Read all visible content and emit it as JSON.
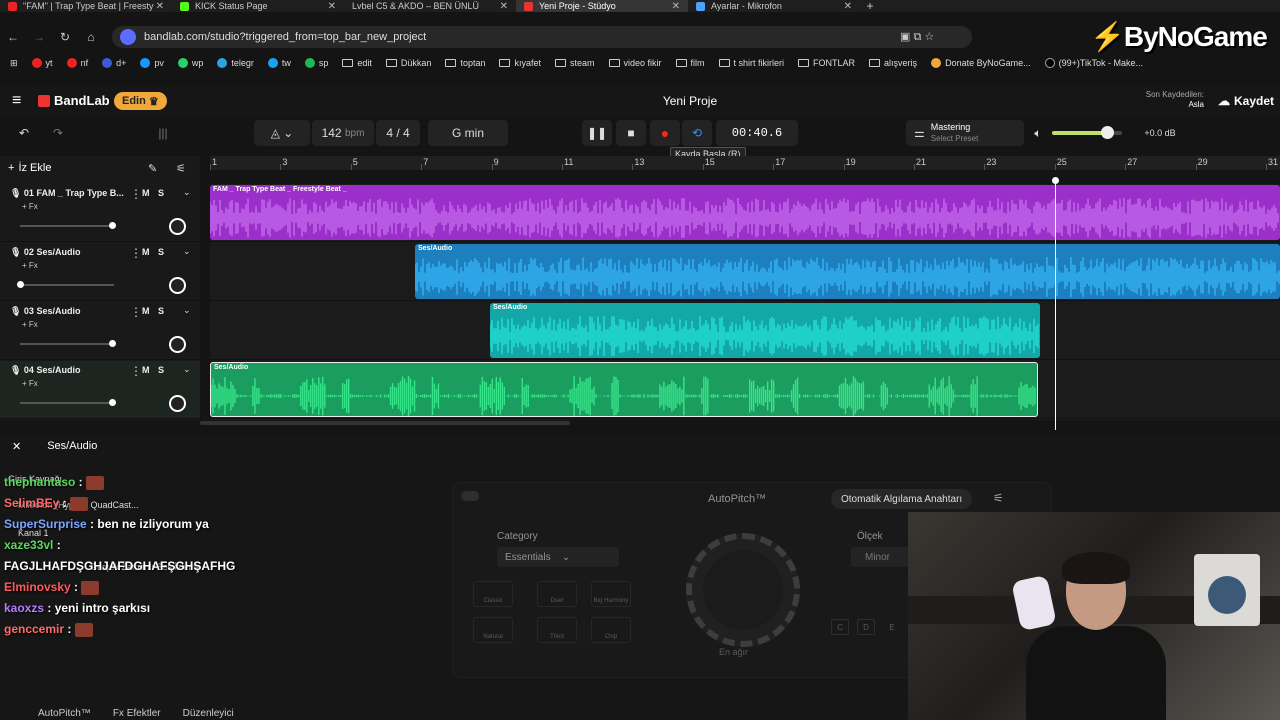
{
  "browser": {
    "tabs": [
      {
        "label": "\"FAM\" | Trap Type Beat | Freesty",
        "color": "#e22"
      },
      {
        "label": "KICK Status Page",
        "color": "#53fc18"
      },
      {
        "label": "Lvbel C5 & AKDO – BEN ÜNLÜ",
        "color": ""
      },
      {
        "label": "Yeni Proje - Stüdyo",
        "color": "#e33"
      },
      {
        "label": "Ayarlar - Mikrofon",
        "color": "#4aa3ff"
      }
    ],
    "url": "bandlab.com/studio?triggered_from=top_bar_new_project",
    "bookmarks": [
      {
        "label": "yt",
        "color": "#e22"
      },
      {
        "label": "nf",
        "color": "#e22"
      },
      {
        "label": "d+",
        "color": "#3b5bd6"
      },
      {
        "label": "pv",
        "color": "#1a98ff"
      },
      {
        "label": "wp",
        "color": "#25d366"
      },
      {
        "label": "telegr",
        "color": "#2aa3e0"
      },
      {
        "label": "tw",
        "color": "#1da1f2"
      },
      {
        "label": "sp",
        "color": "#1db954"
      },
      {
        "label": "edit",
        "color": ""
      },
      {
        "label": "Dükkan",
        "color": ""
      },
      {
        "label": "toptan",
        "color": ""
      },
      {
        "label": "kıyafet",
        "color": ""
      },
      {
        "label": "steam",
        "color": ""
      },
      {
        "label": "video fikir",
        "color": ""
      },
      {
        "label": "film",
        "color": ""
      },
      {
        "label": "t shirt fikirleri",
        "color": ""
      },
      {
        "label": "FONTLAR",
        "color": ""
      },
      {
        "label": "alışveriş",
        "color": ""
      },
      {
        "label": "Donate ByNoGame...",
        "color": "#f1a83a"
      },
      {
        "label": "(99+)TikTok - Make...",
        "color": "#000"
      }
    ],
    "logo": "ByNoGame"
  },
  "bandlab": {
    "logo": "BandLab",
    "edin_label": "Edin",
    "project_title": "Yeni Proje",
    "saved_label": "Son Kaydedilen:",
    "saved_value": "Asla",
    "kaydet_label": "Kaydet"
  },
  "transport": {
    "bpm": "142",
    "bpm_unit": "bpm",
    "time_sig": "4 / 4",
    "key": "G min",
    "time": "00:40.6",
    "tooltip": "Kayda Başla (R)",
    "mastering_title": "Mastering",
    "mastering_sub": "Select Preset",
    "db": "+0.0 dB",
    "volume_level": 0.78
  },
  "tracks_header": {
    "add_label": "İz Ekle"
  },
  "ruler": [
    "1",
    "3",
    "5",
    "7",
    "9",
    "11",
    "13",
    "15",
    "17",
    "19",
    "21",
    "23",
    "25",
    "27",
    "29",
    "31"
  ],
  "tracks": [
    {
      "name": "01  FAM _ Trap Type B...",
      "fx": "+ Fx",
      "ms": "M S",
      "fader": 0.98,
      "clip_label": "FAM _ Trap Type Beat _ Freestyle Beat _",
      "color": "#9b2fc9",
      "wave": "#c46bf0"
    },
    {
      "name": "02  Ses/Audio",
      "fx": "+ Fx",
      "ms": "M S",
      "fader": 0.0,
      "clip_label": "Ses/Audio",
      "color": "#1e7fbf",
      "wave": "#34b4f5"
    },
    {
      "name": "03  Ses/Audio",
      "fx": "+ Fx",
      "ms": "M S",
      "fader": 0.98,
      "clip_label": "Ses/Audio",
      "color": "#13a7a7",
      "wave": "#25e0d8"
    },
    {
      "name": "04  Ses/Audio",
      "fx": "+ Fx",
      "ms": "M S",
      "fader": 0.98,
      "clip_label": "Ses/Audio",
      "color": "#1b9d5f",
      "wave": "#36e58a"
    }
  ],
  "bottom": {
    "title": "Ses/Audio",
    "autopitch_title": "AutoPitch™",
    "auto_key_label": "Otomatik Algılama Anahtarı",
    "category_label": "Category",
    "category_value": "Essentials",
    "modes": [
      "Classic",
      "Duet",
      "Big Harmony",
      "Natural",
      "Third",
      "Chip"
    ],
    "dial_label": "En ağır",
    "scale_label": "Ölçek",
    "scale_value": "Minor",
    "keys": [
      "C",
      "D",
      "E"
    ],
    "footer": [
      "AutoPitch™",
      "Fx  Efektler",
      "Düzenleyici"
    ]
  },
  "chat": [
    {
      "user": "thephantaso",
      "color": "#5cd65c",
      "text": ""
    },
    {
      "user": "SelimBEy",
      "color": "#ff6b6b",
      "text": ""
    },
    {
      "user": "SuperSurprise",
      "color": "#7aa8ff",
      "text": "ben ne izliyorum ya"
    },
    {
      "user": "xaze33vl",
      "color": "#5cd65c",
      "text": "FAGJLHAFDŞGHJAFDGHAFŞGHŞAFHG"
    },
    {
      "user": "Elminovsky",
      "color": "#ff5a5a",
      "text": ""
    },
    {
      "user": "kaoxzs",
      "color": "#b47cff",
      "text": "yeni intro şarkısı"
    },
    {
      "user": "genccemir",
      "color": "#ff6b6b",
      "text": ""
    }
  ],
  "under_chat": {
    "input_source": "Giriş Kaynağı",
    "mic": "Mikrofon (HyperX QuadCast...",
    "channel": "Kanal 1",
    "monitor": "Gerçek Zamanlı Ses İzleme"
  }
}
